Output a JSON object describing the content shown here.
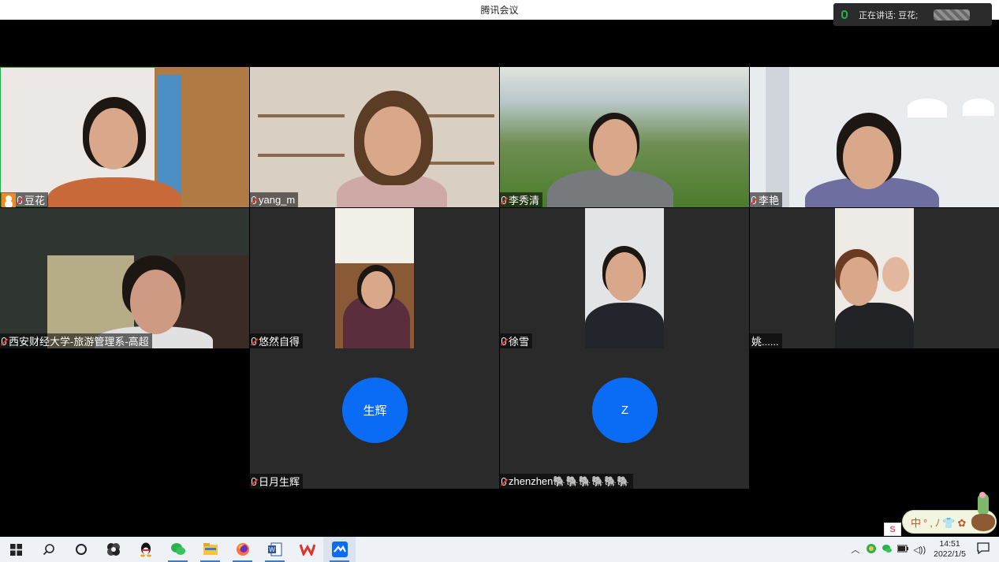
{
  "window": {
    "title": "腾讯会议"
  },
  "speaking": {
    "label": "正在讲话: 豆花;"
  },
  "participants": [
    {
      "name": "豆花",
      "host": true
    },
    {
      "name": "yang_m"
    },
    {
      "name": "李秀清"
    },
    {
      "name": "李艳"
    },
    {
      "name": "西安财经大学-旅游管理系-高超"
    },
    {
      "name": "悠然自得"
    },
    {
      "name": "徐雪"
    },
    {
      "name": "姚......"
    },
    {
      "name": "日月生辉",
      "avatar": "生辉"
    },
    {
      "name": "zhenzhen🐘🐘🐘🐘🐘🐘",
      "avatar": "Z"
    }
  ],
  "taskbar": {
    "icons": [
      "windows-start-icon",
      "search-icon",
      "task-view-icon",
      "app-icon",
      "qq-icon",
      "wechat-icon",
      "file-explorer-icon",
      "firefox-icon",
      "word-icon",
      "wps-icon",
      "tencent-meeting-icon"
    ]
  },
  "tray": {
    "time": "14:51",
    "date": "2022/1/5",
    "volume": "◁))"
  },
  "ime": {
    "text": "中°,ﾉ👕✿",
    "sogou": "S"
  },
  "colors": {
    "accent": "#0a6cf5",
    "active_border": "#1fb14a",
    "tile_bg": "#2a2a2a"
  }
}
